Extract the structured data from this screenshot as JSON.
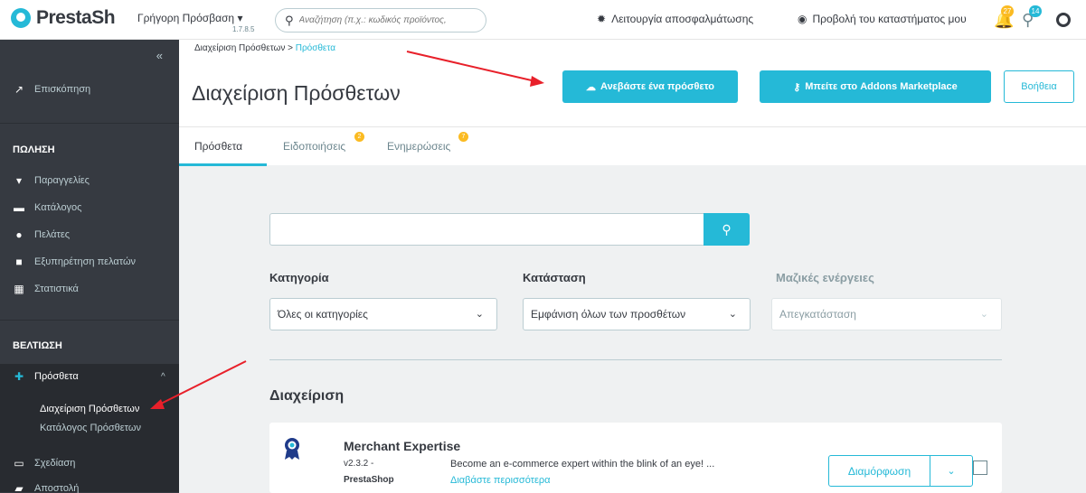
{
  "header": {
    "logo_text": "PrestaSh",
    "quick_access": "Γρήγορη Πρόσβαση",
    "version": "1.7.8.5",
    "search_placeholder": "Αναζήτηση (π.χ.: κωδικός προϊόντος, ",
    "debug_mode": "Λειτουργία αποσφαλμάτωσης",
    "view_shop": "Προβολή του καταστήματος μου",
    "notifications": [
      {
        "icon": "bell-icon",
        "count": "27",
        "color": "#fbbb22"
      },
      {
        "icon": "people-icon",
        "count": "14",
        "color": "#25b9d7"
      }
    ]
  },
  "sidebar": {
    "collapse": "«",
    "dashboard": "Επισκόπηση",
    "sections": [
      {
        "title": "ΠΩΛΗΣΗ",
        "items": [
          {
            "icon": "basket-icon",
            "label": "Παραγγελίες"
          },
          {
            "icon": "store-icon",
            "label": "Κατάλογος"
          },
          {
            "icon": "user-icon",
            "label": "Πελάτες"
          },
          {
            "icon": "chat-icon",
            "label": "Εξυπηρέτηση πελατών"
          },
          {
            "icon": "stats-icon",
            "label": "Στατιστικά"
          }
        ]
      },
      {
        "title": "ΒΕΛΤΙΩΣΗ",
        "items": [
          {
            "icon": "puzzle-icon",
            "label": "Πρόσθετα"
          }
        ]
      }
    ],
    "subitems": [
      {
        "label": "Διαχείριση Πρόσθετων"
      },
      {
        "label": "Κατάλογος Πρόσθετων"
      }
    ],
    "after_items": [
      {
        "icon": "monitor-icon",
        "label": "Σχεδίαση"
      },
      {
        "icon": "truck-icon",
        "label": "Αποστολή"
      }
    ]
  },
  "page": {
    "breadcrumb_parent": "Διαχείριση Πρόσθετων",
    "breadcrumb_sep": ">",
    "breadcrumb_current": "Πρόσθετα",
    "title": "Διαχείριση Πρόσθετων",
    "upload_button": "Ανεβάστε ένα πρόσθετο",
    "marketplace_button": "Μπείτε στο Addons Marketplace",
    "help_button": "Βοήθεια",
    "tabs": [
      {
        "label": "Πρόσθετα",
        "badge": ""
      },
      {
        "label": "Ειδοποιήσεις",
        "badge": "2"
      },
      {
        "label": "Ενημερώσεις",
        "badge": "7"
      }
    ]
  },
  "filters": {
    "category_label": "Κατηγορία",
    "category_value": "Όλες οι κατηγορίες",
    "status_label": "Κατάσταση",
    "status_value": "Εμφάνιση όλων των προσθέτων",
    "bulk_label": "Μαζικές ενέργειες",
    "bulk_value": "Απεγκατάσταση"
  },
  "manage": {
    "title": "Διαχείριση",
    "module": {
      "name": "Merchant Expertise",
      "version": "v2.3.2 -",
      "author": "PrestaShop",
      "description": "Become an e-commerce expert within the blink of an eye! ...",
      "read_more": "Διαβάστε περισσότερα",
      "configure": "Διαμόρφωση"
    }
  },
  "colors": {
    "primary": "#25b9d7",
    "sidebar_bg": "#363a41",
    "annotation_arrow": "#e8202a"
  }
}
